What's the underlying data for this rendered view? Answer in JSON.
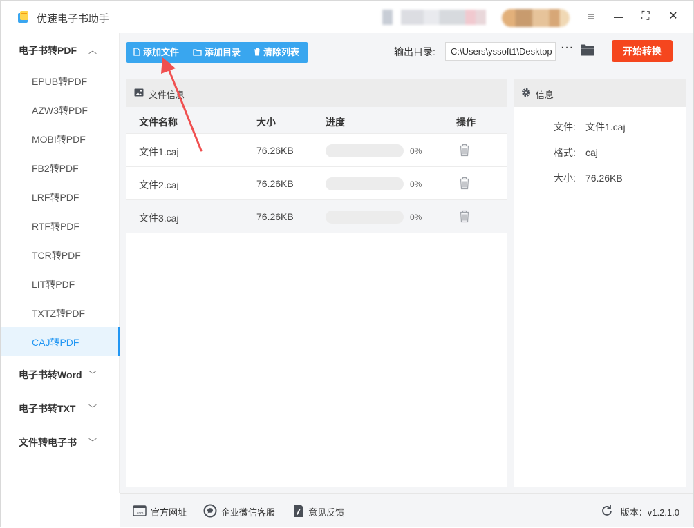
{
  "app": {
    "title": "优速电子书助手"
  },
  "window_controls": {
    "menu": "≡",
    "minimize": "—",
    "maximize": "⛶",
    "close": "✕"
  },
  "sidebar": {
    "groups": [
      {
        "label": "电子书转PDF",
        "expanded": true
      },
      {
        "label": "电子书转Word",
        "expanded": false
      },
      {
        "label": "电子书转TXT",
        "expanded": false
      },
      {
        "label": "文件转电子书",
        "expanded": false
      }
    ],
    "pdf_items": [
      {
        "label": "EPUB转PDF"
      },
      {
        "label": "AZW3转PDF"
      },
      {
        "label": "MOBI转PDF"
      },
      {
        "label": "FB2转PDF"
      },
      {
        "label": "LRF转PDF"
      },
      {
        "label": "RTF转PDF"
      },
      {
        "label": "TCR转PDF"
      },
      {
        "label": "LIT转PDF"
      },
      {
        "label": "TXTZ转PDF"
      },
      {
        "label": "CAJ转PDF",
        "active": true
      }
    ]
  },
  "toolbar": {
    "add_file": "添加文件",
    "add_folder": "添加目录",
    "clear_list": "清除列表",
    "output_label": "输出目录:",
    "output_path": "C:\\Users\\yssoft1\\Desktop",
    "more": "···",
    "start": "开始转换"
  },
  "file_panel": {
    "title": "文件信息",
    "columns": {
      "name": "文件名称",
      "size": "大小",
      "progress": "进度",
      "action": "操作"
    },
    "rows": [
      {
        "name": "文件1.caj",
        "size": "76.26KB",
        "progress": 0,
        "progress_text": "0%"
      },
      {
        "name": "文件2.caj",
        "size": "76.26KB",
        "progress": 0,
        "progress_text": "0%"
      },
      {
        "name": "文件3.caj",
        "size": "76.26KB",
        "progress": 0,
        "progress_text": "0%"
      }
    ]
  },
  "info_panel": {
    "title": "信息",
    "file_key": "文件:",
    "file_value": "文件1.caj",
    "format_key": "格式:",
    "format_value": "caj",
    "size_key": "大小:",
    "size_value": "76.26KB"
  },
  "footer": {
    "website": "官方网址",
    "wechat": "企业微信客服",
    "feedback": "意见反馈",
    "version": "版本：v1.2.1.0"
  },
  "colors": {
    "accent": "#39a6ef",
    "start": "#f5461e",
    "active_item": "#2196f3",
    "arrow": "#f05050"
  },
  "icons": [
    "file-icon",
    "folder-icon",
    "trash-icon",
    "image-icon",
    "gear-icon",
    "web-icon",
    "chat-icon",
    "feedback-icon",
    "refresh-icon"
  ]
}
